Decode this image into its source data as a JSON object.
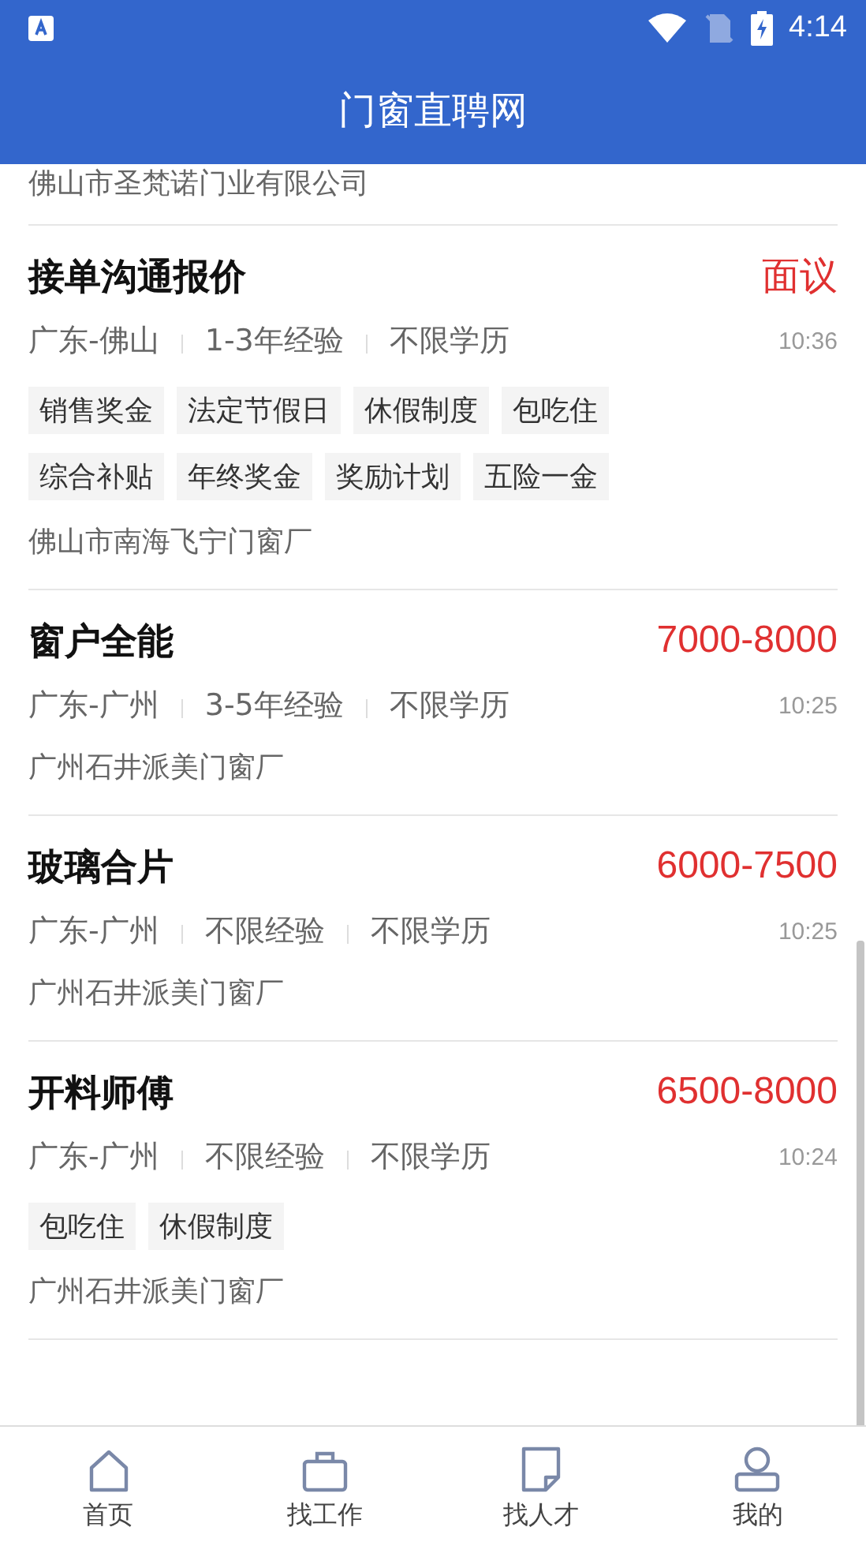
{
  "status_bar": {
    "time": "4:14"
  },
  "app_bar": {
    "title": "门窗直聘网"
  },
  "partial_company": "佛山市圣梵诺门业有限公司",
  "jobs": [
    {
      "title": "接单沟通报价",
      "salary": "面议",
      "location": "广东-佛山",
      "experience": "1-3年经验",
      "education": "不限学历",
      "time": "10:36",
      "tags": [
        "销售奖金",
        "法定节假日",
        "休假制度",
        "包吃住",
        "综合补贴",
        "年终奖金",
        "奖励计划",
        "五险一金"
      ],
      "company": "佛山市南海飞宁门窗厂"
    },
    {
      "title": "窗户全能",
      "salary": "7000-8000",
      "location": "广东-广州",
      "experience": "3-5年经验",
      "education": "不限学历",
      "time": "10:25",
      "company": "广州石井派美门窗厂"
    },
    {
      "title": "玻璃合片",
      "salary": "6000-7500",
      "location": "广东-广州",
      "experience": "不限经验",
      "education": "不限学历",
      "time": "10:25",
      "company": "广州石井派美门窗厂"
    },
    {
      "title": "开料师傅",
      "salary": "6500-8000",
      "location": "广东-广州",
      "experience": "不限经验",
      "education": "不限学历",
      "time": "10:24",
      "tags": [
        "包吃住",
        "休假制度"
      ],
      "company": "广州石井派美门窗厂"
    }
  ],
  "nav": [
    {
      "label": "首页",
      "selected": false
    },
    {
      "label": "找工作",
      "selected": false
    },
    {
      "label": "找人才",
      "selected": false
    },
    {
      "label": "我的",
      "selected": false
    }
  ]
}
